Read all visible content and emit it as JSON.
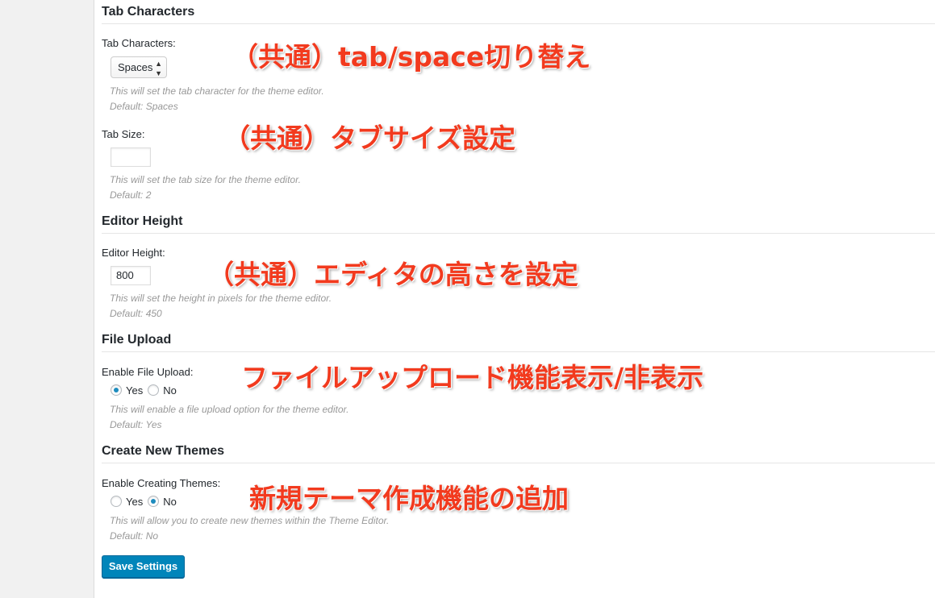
{
  "sections": {
    "tab_characters": {
      "title": "Tab Characters",
      "field_label": "Tab Characters:",
      "select_value": "Spaces",
      "description": "This will set the tab character for the theme editor.",
      "default": "Default: Spaces"
    },
    "tab_size": {
      "field_label": "Tab Size:",
      "input_value": "",
      "description": "This will set the tab size for the theme editor.",
      "default": "Default: 2"
    },
    "editor_height": {
      "title": "Editor Height",
      "field_label": "Editor Height:",
      "input_value": "800",
      "description": "This will set the height in pixels for the theme editor.",
      "default": "Default: 450"
    },
    "file_upload": {
      "title": "File Upload",
      "field_label": "Enable File Upload:",
      "option_yes": "Yes",
      "option_no": "No",
      "selected": "Yes",
      "description": "This will enable a file upload option for the theme editor.",
      "default": "Default: Yes"
    },
    "create_themes": {
      "title": "Create New Themes",
      "field_label": "Enable Creating Themes:",
      "option_yes": "Yes",
      "option_no": "No",
      "selected": "No",
      "description": "This will allow you to create new themes within the Theme Editor.",
      "default": "Default: No"
    }
  },
  "save_button": "Save Settings",
  "annotations": {
    "tab_space": "（共通）tab/space切り替え",
    "tab_size": "（共通）タブサイズ設定",
    "editor_height": "（共通）エディタの高さを設定",
    "file_upload": "ファイルアップロード機能表示/非表示",
    "create_themes": "新規テーマ作成機能の追加"
  },
  "colors": {
    "accent": "#0085ba",
    "annotation": "#f23a1e",
    "description_text": "#999999",
    "sidebar_bg": "#f1f1f1"
  }
}
